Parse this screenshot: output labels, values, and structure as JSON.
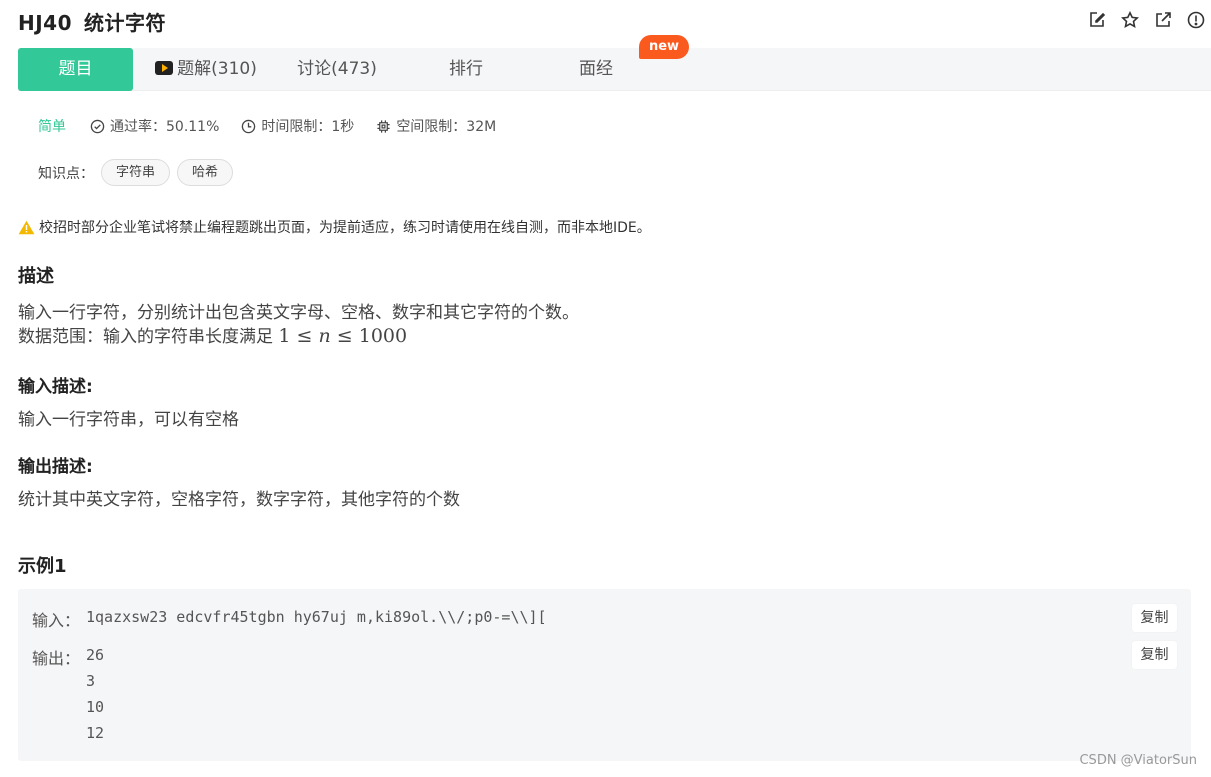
{
  "problem": {
    "code": "HJ40",
    "name": "统计字符"
  },
  "tabs": [
    {
      "label": "题目"
    },
    {
      "label": "题解(310)"
    },
    {
      "label": "讨论(473)"
    },
    {
      "label": "排行"
    },
    {
      "label": "面经"
    }
  ],
  "new_badge": "new",
  "meta": {
    "difficulty": "简单",
    "pass_rate": "通过率：50.11%",
    "time_limit": "时间限制：1秒",
    "space_limit": "空间限制：32M"
  },
  "knowledge": {
    "label": "知识点：",
    "tags": [
      "字符串",
      "哈希"
    ]
  },
  "warning": "校招时部分企业笔试将禁止编程题跳出页面，为提前适应，练习时请使用在线自测，而非本地IDE。",
  "description": {
    "heading": "描述",
    "line1": "输入一行字符，分别统计出包含英文字母、空格、数字和其它字符的个数。",
    "line2_prefix": "数据范围：输入的字符串长度满足"
  },
  "input_desc": {
    "heading": "输入描述:",
    "text": "输入一行字符串，可以有空格"
  },
  "output_desc": {
    "heading": "输出描述:",
    "text": "统计其中英文字符，空格字符，数字字符，其他字符的个数"
  },
  "example": {
    "heading": "示例1",
    "input_label": "输入：",
    "input_value": "1qazxsw23 edcvfr45tgbn hy67uj m,ki89ol.\\\\/;p0-=\\\\][",
    "output_label": "输出：",
    "output_lines": [
      "26",
      "3",
      "10",
      "12"
    ],
    "copy_label": "复制"
  },
  "watermark": "CSDN @ViatorSun"
}
